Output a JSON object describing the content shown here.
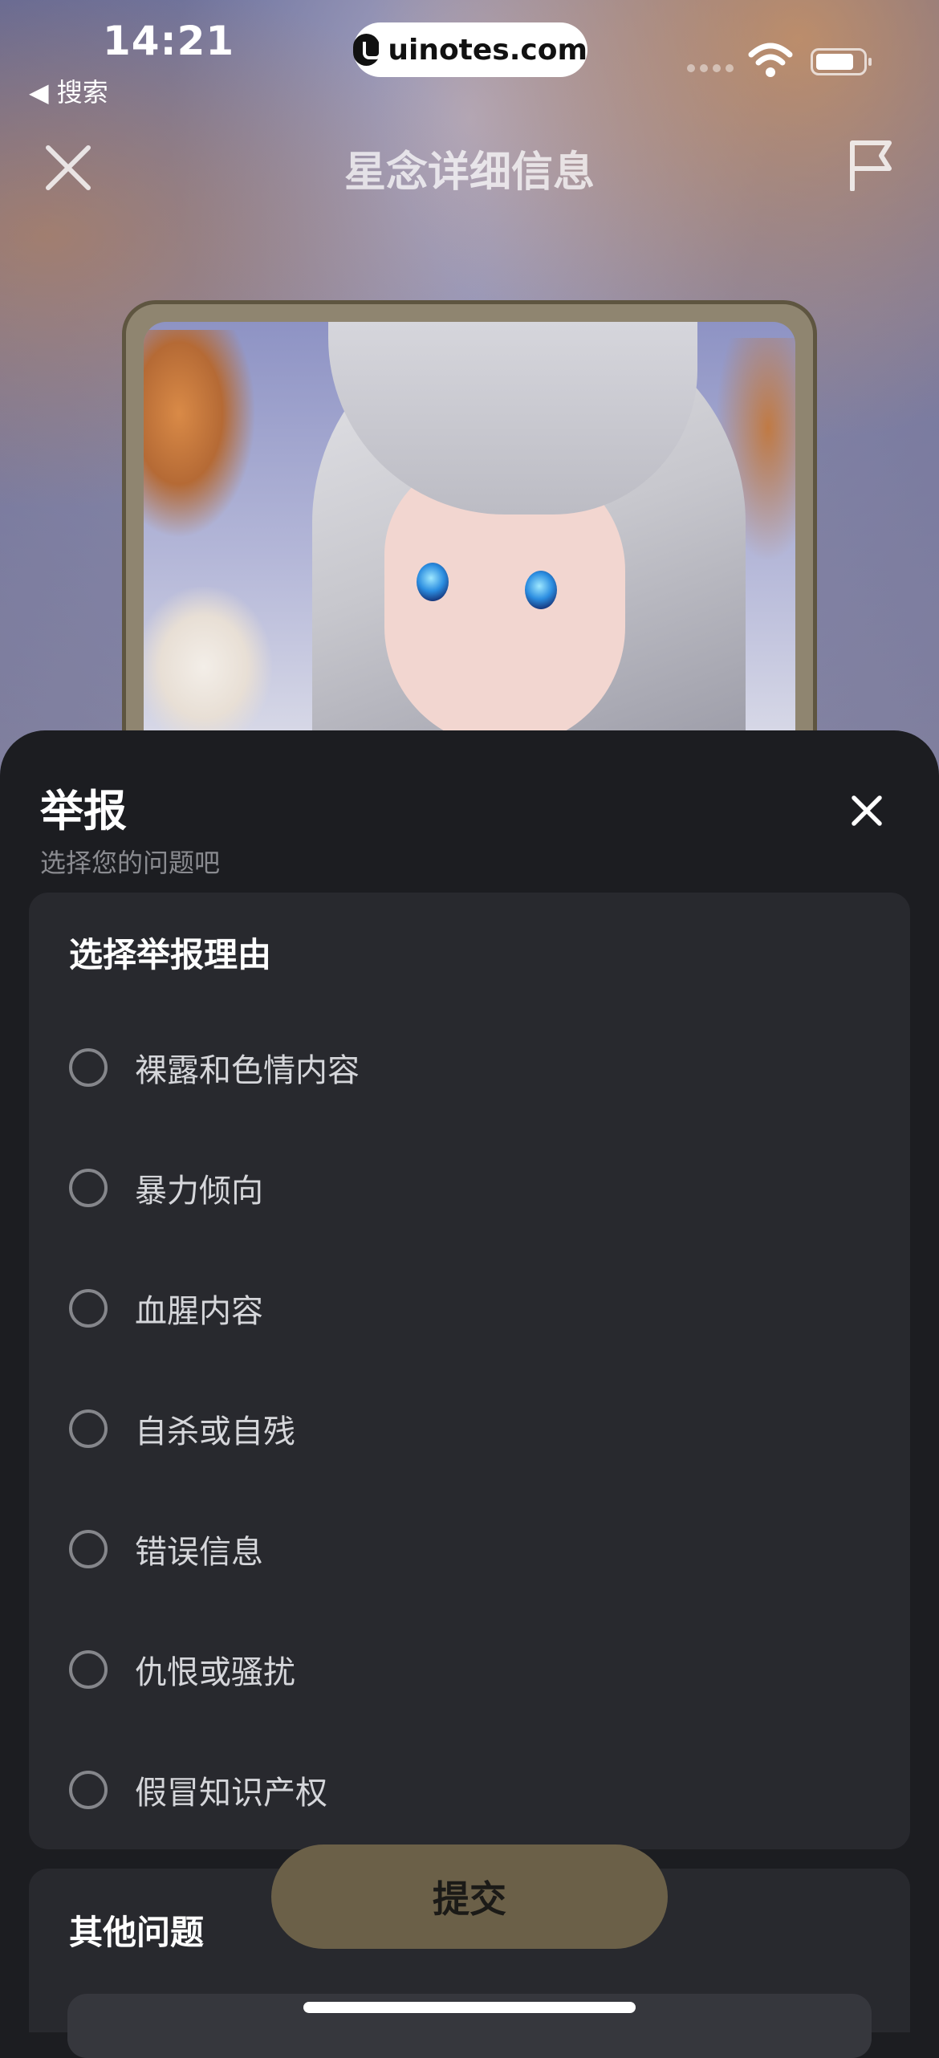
{
  "status_bar": {
    "time": "14:21",
    "back_label": "◀ 搜索",
    "url": "uinotes.com"
  },
  "header": {
    "title": "星念详细信息",
    "close_icon": "close-icon",
    "report_icon": "flag-icon"
  },
  "report_sheet": {
    "title": "举报",
    "subtitle": "选择您的问题吧",
    "reasons_heading": "选择举报理由",
    "reasons": [
      "裸露和色情内容",
      "暴力倾向",
      "血腥内容",
      "自杀或自残",
      "错误信息",
      "仇恨或骚扰",
      "假冒知识产权"
    ],
    "other_heading": "其他问题",
    "submit_label": "提交"
  },
  "colors": {
    "sheet_bg": "#1c1d21",
    "panel_bg": "#28292e",
    "submit_bg": "#6b6048"
  }
}
